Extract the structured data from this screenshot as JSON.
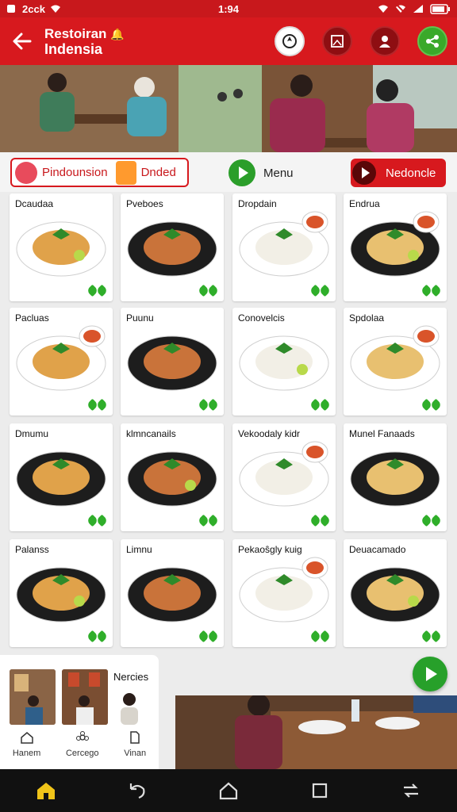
{
  "status_bar": {
    "left_text": "2cck",
    "time": "1:94"
  },
  "app_bar": {
    "title_line1": "Restoiran",
    "title_line2": "Indensia"
  },
  "filter": {
    "chip_label": "Pindounsion",
    "chip_tag": "Dnded",
    "menu_label": "Menu",
    "red_button_label": "Nedoncle"
  },
  "menu_items": [
    {
      "name": "Dcaudaa"
    },
    {
      "name": "Pvebоes"
    },
    {
      "name": "Dropdain"
    },
    {
      "name": "Endrua"
    },
    {
      "name": "Pacluas"
    },
    {
      "name": "Puunu"
    },
    {
      "name": "Conovelcis"
    },
    {
      "name": "Spdolaa"
    },
    {
      "name": "Dmumu"
    },
    {
      "name": "klmncanails"
    },
    {
      "name": "Vekoodaly kidr"
    },
    {
      "name": "Munel Fanaads"
    },
    {
      "name": "Palanss"
    },
    {
      "name": "Limnu"
    },
    {
      "name": "Pekaoŝgly kuig"
    },
    {
      "name": "Deuacamado"
    }
  ],
  "bottom_panel": {
    "title": "Nercies",
    "tabs": [
      {
        "label": "Hanem"
      },
      {
        "label": "Cercego"
      },
      {
        "label": "Vinan"
      }
    ]
  },
  "colors": {
    "primary": "#d7191e",
    "accent_green": "#2b9e2a"
  }
}
